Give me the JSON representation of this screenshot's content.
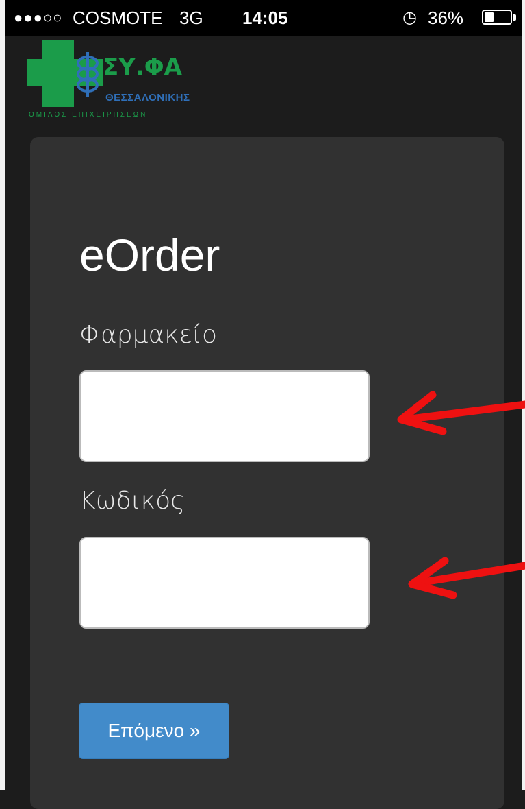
{
  "status_bar": {
    "signal": "●●●○○",
    "carrier": "COSMOTE",
    "network": "3G",
    "time": "14:05",
    "alarm_icon": "alarm-clock-icon",
    "battery_percent": "36%",
    "battery_level": 0.36
  },
  "logo": {
    "text": "ΣΥ.ΦΑ",
    "sub": "ΘΕΣΣΑΛΟΝΙΚΗΣ",
    "tag": "ΟΜΙΛΟΣ ΕΠΙΧΕΙΡΗΣΕΩΝ",
    "colors": {
      "green": "#1b9c4a",
      "blue": "#2f6fb8"
    }
  },
  "form": {
    "title": "eOrder",
    "pharmacy_label": "Φαρμακείο",
    "pharmacy_value": "",
    "code_label": "Κωδικός",
    "code_value": "",
    "next_label": "Επόμενο »"
  },
  "colors": {
    "background": "#1c1c1c",
    "panel": "#313131",
    "button": "#428bca",
    "annotation_arrow": "#ee1111"
  }
}
